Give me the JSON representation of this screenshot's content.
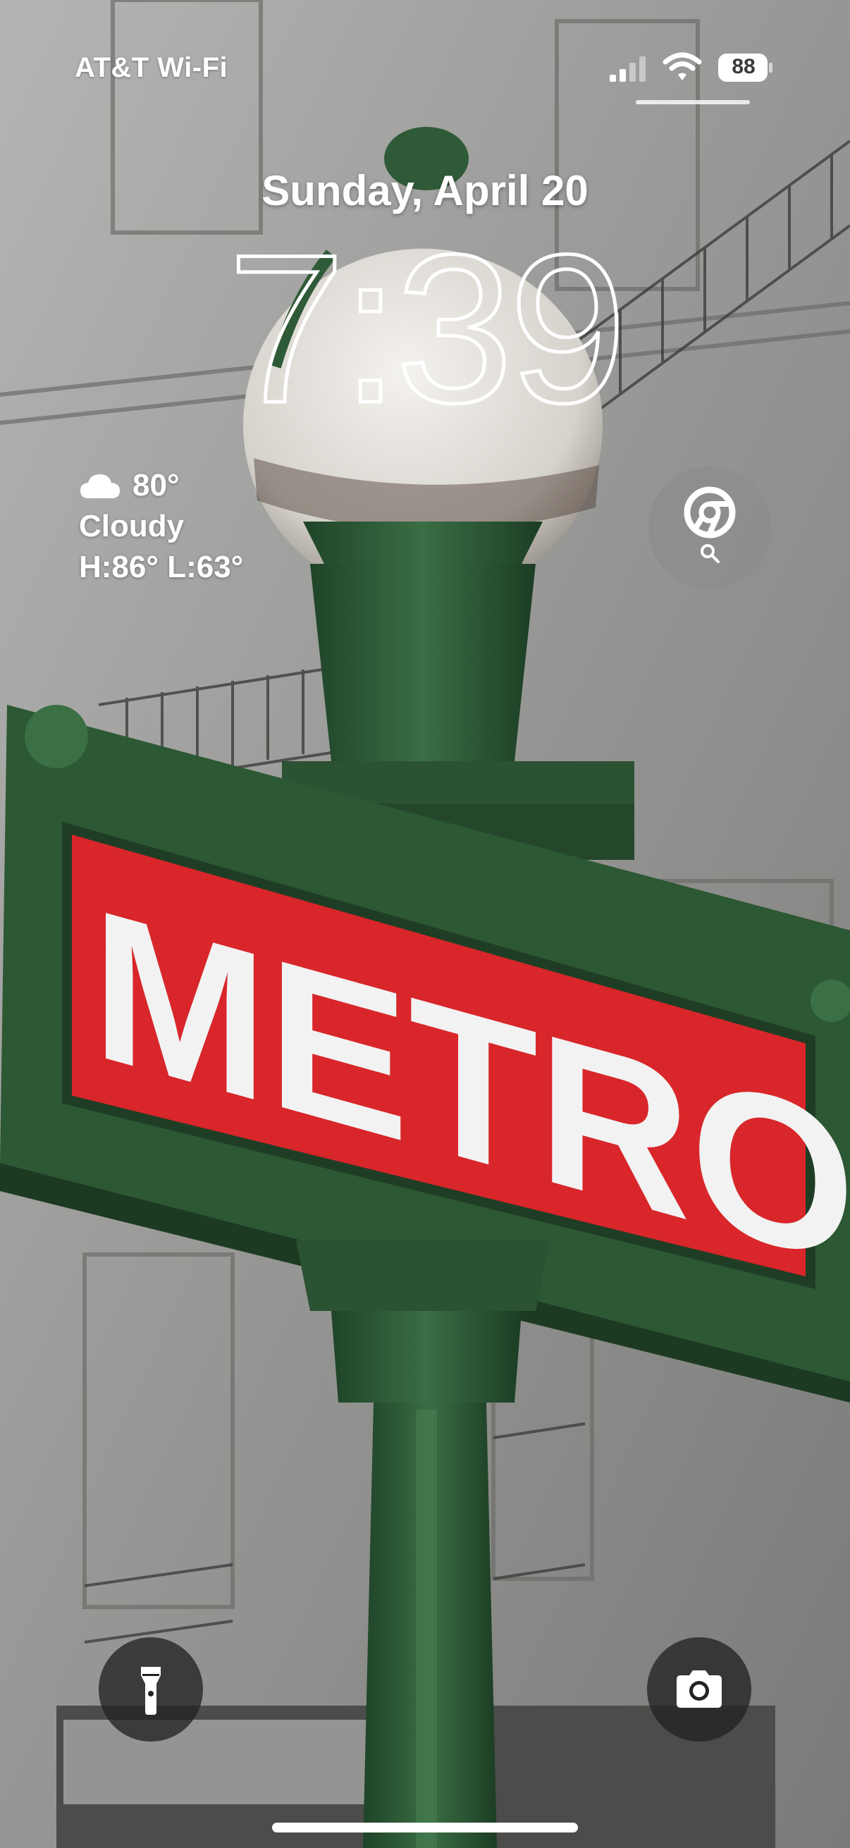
{
  "status_bar": {
    "carrier": "AT&T Wi-Fi",
    "battery_percent": "88",
    "signal_icon": "cellular-signal-icon",
    "wifi_icon": "wifi-icon",
    "battery_icon": "battery-icon"
  },
  "lock_screen": {
    "date": "Sunday, April 20",
    "time": "7:39"
  },
  "weather": {
    "icon": "cloud-icon",
    "temperature": "80°",
    "condition": "Cloudy",
    "high_low": "H:86° L:63°"
  },
  "widgets": {
    "chrome_search": {
      "icon": "chrome-icon",
      "sub_icon": "search-icon"
    }
  },
  "controls": {
    "flashlight": {
      "icon": "flashlight-icon"
    },
    "camera": {
      "icon": "camera-icon"
    }
  },
  "wallpaper": {
    "sign_text": "METRO",
    "colors": {
      "sign_red": "#d8262a",
      "ironwork_green": "#2e5a36",
      "facade_gray": "#9a9a98"
    }
  }
}
